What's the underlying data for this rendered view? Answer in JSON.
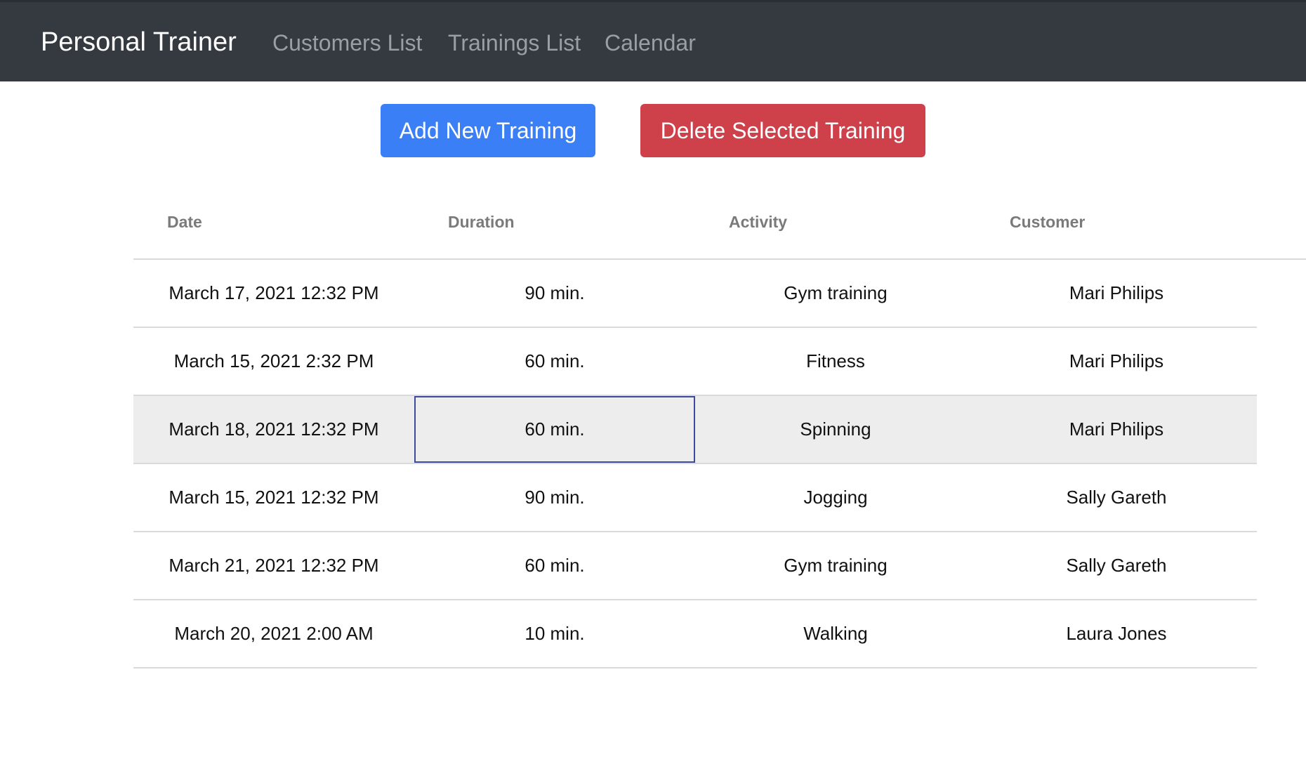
{
  "navbar": {
    "brand": "Personal Trainer",
    "links": [
      "Customers List",
      "Trainings List",
      "Calendar"
    ]
  },
  "actions": {
    "add_label": "Add New Training",
    "delete_label": "Delete Selected Training"
  },
  "table": {
    "columns": [
      "Date",
      "Duration",
      "Activity",
      "Customer"
    ],
    "rows": [
      [
        "March 17, 2021 12:32 PM",
        "90 min.",
        "Gym training",
        "Mari Philips"
      ],
      [
        "March 15, 2021 2:32 PM",
        "60 min.",
        "Fitness",
        "Mari Philips"
      ],
      [
        "March 18, 2021 12:32 PM",
        "60 min.",
        "Spinning",
        "Mari Philips"
      ],
      [
        "March 15, 2021 12:32 PM",
        "90 min.",
        "Jogging",
        "Sally Gareth"
      ],
      [
        "March 21, 2021 12:32 PM",
        "60 min.",
        "Gym training",
        "Sally Gareth"
      ],
      [
        "March 20, 2021 2:00 AM",
        "10 min.",
        "Walking",
        "Laura Jones"
      ]
    ],
    "selected_row": 2,
    "focused_column": 1
  },
  "colors": {
    "navbar_bg": "#343a40",
    "primary": "#3a7ff5",
    "danger": "#cf414a",
    "selected_row_bg": "#ededed",
    "focus_border": "#3d4a9e"
  }
}
